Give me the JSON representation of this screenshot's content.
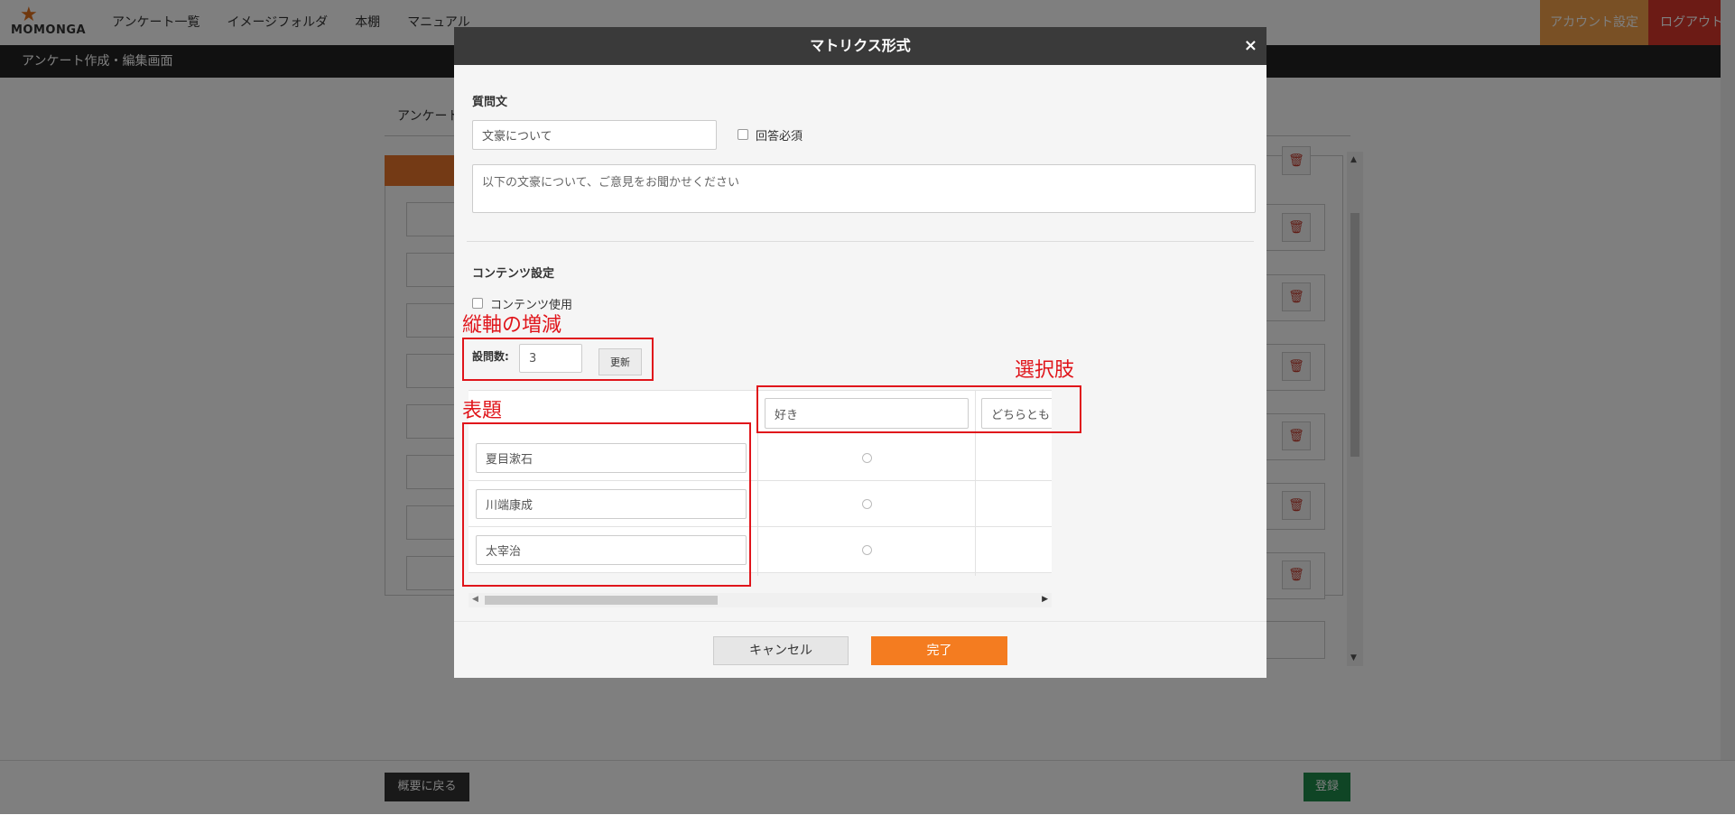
{
  "app": {
    "logo_text": "MOMONGA",
    "nav": [
      "アンケート一覧",
      "イメージフォルダ",
      "本棚",
      "マニュアル"
    ],
    "account_label": "アカウント設定",
    "logout_label": "ログアウト",
    "subtitle": "アンケート作成・編集画面",
    "page_title": "アンケート",
    "back_label": "概要に戻る",
    "register_label": "登録"
  },
  "modal": {
    "title": "マトリクス形式",
    "close_glyph": "×",
    "question_label": "質問文",
    "question_title": "文豪について",
    "required_label": "回答必須",
    "question_body": "以下の文豪について、ご意見をお聞かせください",
    "content_section_label": "コンテンツ設定",
    "content_use_label": "コンテンツ使用",
    "count_label": "設問数:",
    "count_value": "3",
    "update_label": "更新",
    "choices": [
      "好き",
      "どちらとも"
    ],
    "rows": [
      "夏目漱石",
      "川端康成",
      "太宰治"
    ],
    "cancel_label": "キャンセル",
    "done_label": "完了"
  },
  "annotations": {
    "count": "縦軸の増減",
    "rows": "表題",
    "choices": "選択肢"
  },
  "colors": {
    "accent": "#f47c20",
    "annotation": "#e0151b",
    "header_dark": "#3a3a3a"
  }
}
